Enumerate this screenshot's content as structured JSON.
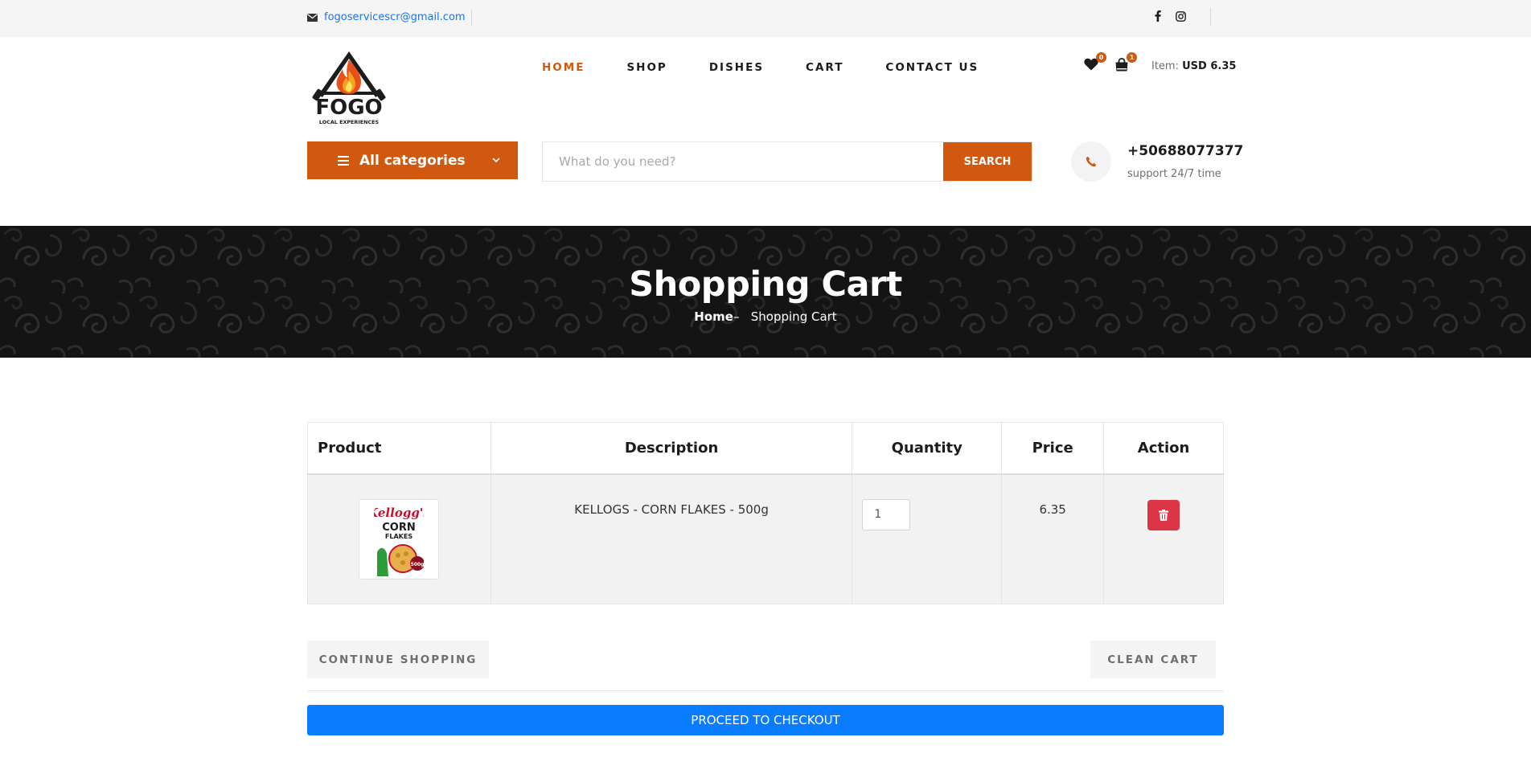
{
  "topbar": {
    "email": "fogoservicescr@gmail.com",
    "social": [
      "facebook-icon",
      "instagram-icon"
    ]
  },
  "brand": {
    "name": "FOGO",
    "tagline": "LOCAL EXPERIENCES"
  },
  "nav": {
    "items": [
      "HOME",
      "SHOP",
      "DISHES",
      "CART",
      "CONTACT US"
    ],
    "active": "HOME"
  },
  "header": {
    "wishlist_count": "0",
    "cart_count": "1",
    "item_label": "Item:",
    "item_total": "USD 6.35"
  },
  "categories": {
    "label": "All categories"
  },
  "search": {
    "placeholder": "What do you need?",
    "button": "SEARCH"
  },
  "support": {
    "phone": "+50688077377",
    "text": "support 24/7 time"
  },
  "banner": {
    "title": "Shopping Cart",
    "crumb_home": "Home",
    "crumb_sep": "–",
    "crumb_current": "Shopping Cart"
  },
  "cart": {
    "headers": {
      "product": "Product",
      "description": "Description",
      "quantity": "Quantity",
      "price": "Price",
      "action": "Action"
    },
    "items": [
      {
        "description": "KELLOGS - CORN FLAKES - 500g",
        "quantity": "1",
        "price": "6.35",
        "thumb_text": [
          "Kellogg's",
          "CORN",
          "FLAKES",
          "500g"
        ]
      }
    ]
  },
  "actions": {
    "continue": "CONTINUE SHOPPING",
    "clean": "CLEAN CART",
    "checkout": "PROCEED TO CHECKOUT"
  },
  "colors": {
    "accent": "#d0590f",
    "primary": "#0a7cff",
    "danger": "#dc3545"
  }
}
